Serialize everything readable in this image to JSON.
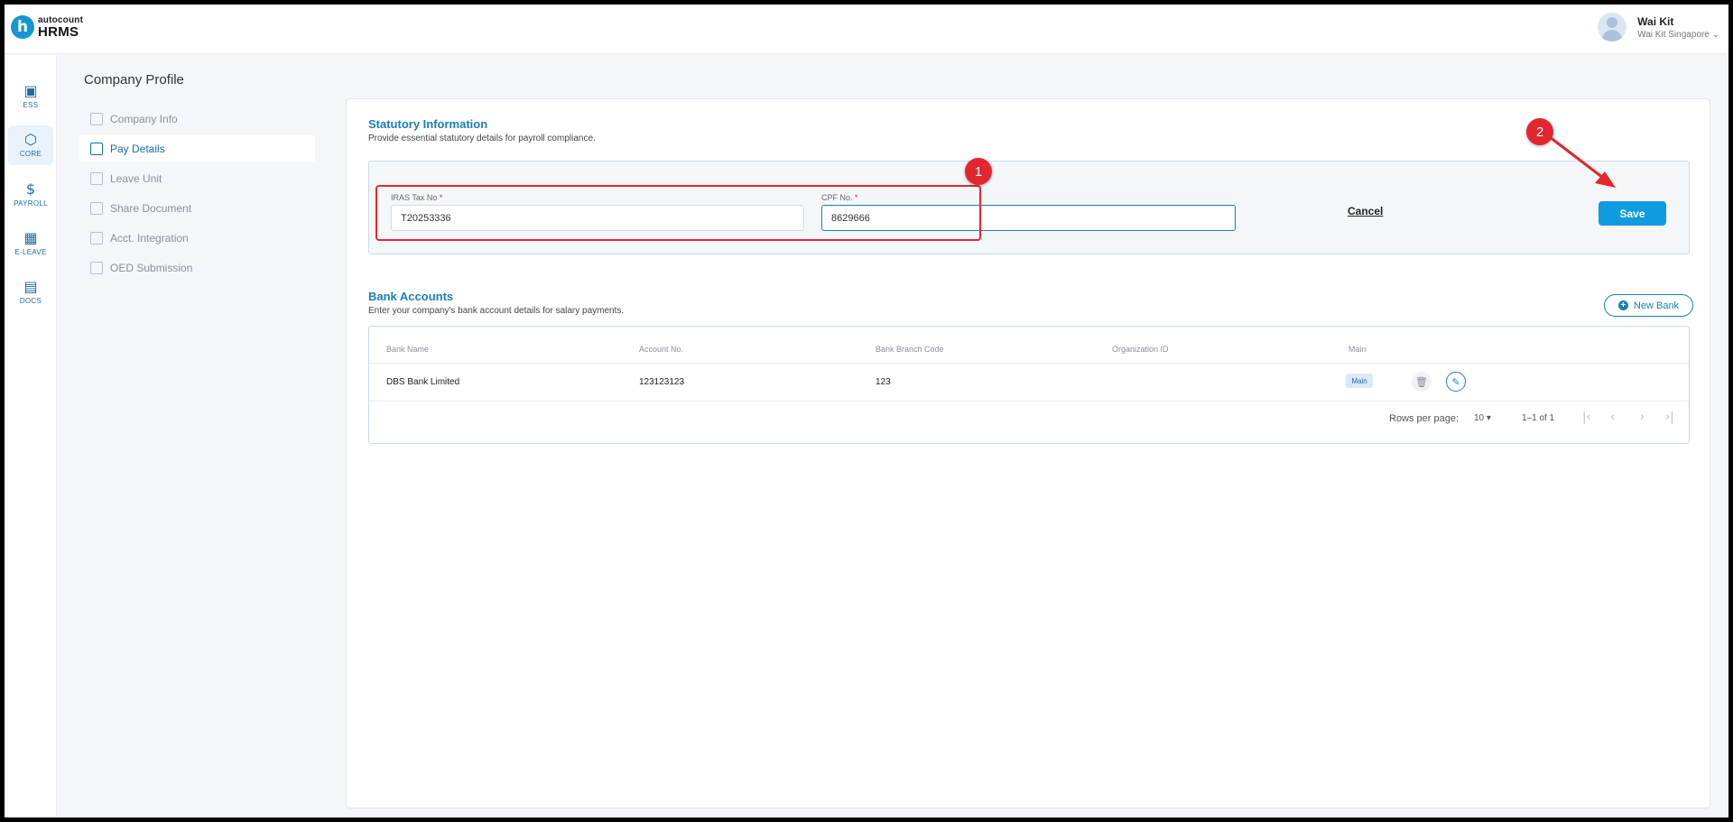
{
  "header": {
    "logo_letter": "h",
    "logo_top": "autocount",
    "logo_bottom": "HRMS",
    "user_name": "Wai Kit",
    "user_company": "Wai Kit Singapore ⌄"
  },
  "rail": [
    {
      "label": "ESS",
      "icon": "id-card-icon",
      "glyph": "▣"
    },
    {
      "label": "CORE",
      "icon": "cube-icon",
      "glyph": "⬡"
    },
    {
      "label": "PAYROLL",
      "icon": "dollar-icon",
      "glyph": "$"
    },
    {
      "label": "E-LEAVE",
      "icon": "calendar-icon",
      "glyph": "▦"
    },
    {
      "label": "DOCS",
      "icon": "document-chart-icon",
      "glyph": "▤"
    }
  ],
  "page_title": "Company Profile",
  "subnav": [
    {
      "label": "Company Info"
    },
    {
      "label": "Pay Details"
    },
    {
      "label": "Leave Unit"
    },
    {
      "label": "Share Document"
    },
    {
      "label": "Acct. Integration"
    },
    {
      "label": "OED Submission"
    }
  ],
  "statutory": {
    "title": "Statutory Information",
    "subtitle": "Provide essential statutory details for payroll compliance.",
    "iras_label": "IRAS Tax No",
    "iras_value": "T20253336",
    "cpf_label": "CPF No.",
    "cpf_value": "8629666",
    "required_mark": "*",
    "cancel": "Cancel",
    "save": "Save"
  },
  "bank": {
    "title": "Bank Accounts",
    "subtitle": "Enter your company's bank account details for salary payments.",
    "new_bank": "New Bank",
    "columns": [
      "Bank Name",
      "Account No.",
      "Bank Branch Code",
      "Organization ID",
      "Main"
    ],
    "rows": [
      {
        "bank_name": "DBS Bank Limited",
        "account_no": "123123123",
        "branch_code": "123",
        "org_id": "",
        "main": "Main"
      }
    ],
    "rows_per_page_label": "Rows per page:",
    "rows_per_page": "10",
    "range": "1–1 of 1"
  },
  "annotations": [
    "1",
    "2"
  ],
  "colors": {
    "accent": "#1a7fb7",
    "save": "#109be0",
    "annotation": "#e3262e"
  }
}
